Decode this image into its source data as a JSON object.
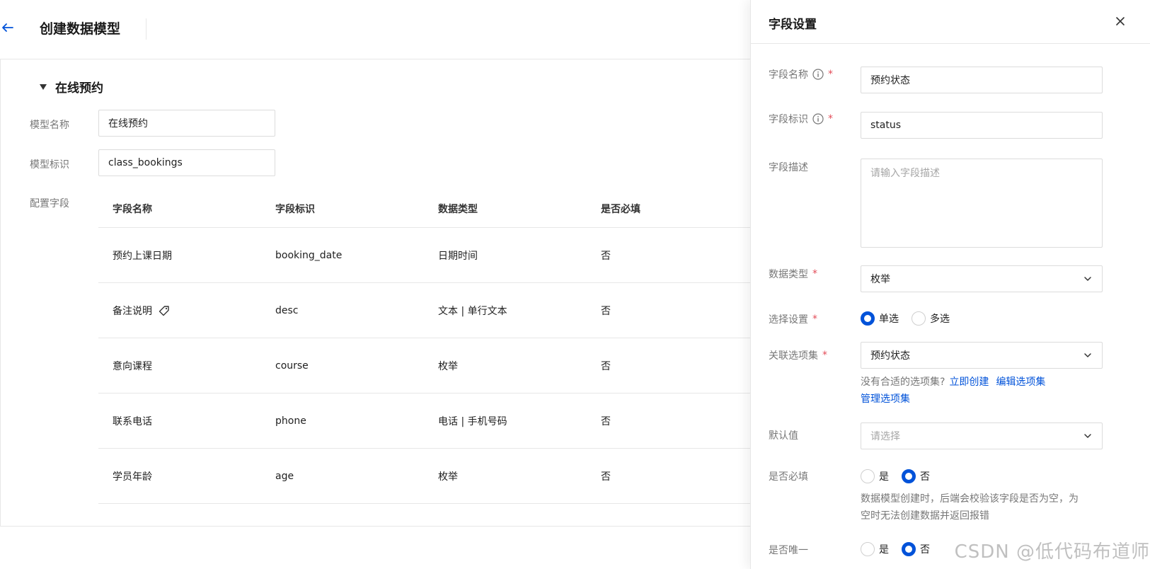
{
  "header": {
    "title": "创建数据模型"
  },
  "section": {
    "title": "在线预约"
  },
  "form": {
    "model_name_label": "模型名称",
    "model_name_value": "在线预约",
    "model_key_label": "模型标识",
    "model_key_value": "class_bookings",
    "fields_label": "配置字段"
  },
  "table": {
    "headers": [
      "字段名称",
      "字段标识",
      "数据类型",
      "是否必填"
    ],
    "rows": [
      {
        "name": "预约上课日期",
        "key": "booking_date",
        "type": "日期时间",
        "required": "否",
        "tag": false
      },
      {
        "name": "备注说明",
        "key": "desc",
        "type": "文本 | 单行文本",
        "required": "否",
        "tag": true
      },
      {
        "name": "意向课程",
        "key": "course",
        "type": "枚举",
        "required": "否",
        "tag": false
      },
      {
        "name": "联系电话",
        "key": "phone",
        "type": "电话 | 手机号码",
        "required": "否",
        "tag": false
      },
      {
        "name": "学员年龄",
        "key": "age",
        "type": "枚举",
        "required": "否",
        "tag": false
      }
    ]
  },
  "drawer": {
    "title": "字段设置",
    "field_name_label": "字段名称",
    "field_name_value": "预约状态",
    "field_key_label": "字段标识",
    "field_key_value": "status",
    "field_desc_label": "字段描述",
    "field_desc_placeholder": "请输入字段描述",
    "data_type_label": "数据类型",
    "data_type_value": "枚举",
    "select_setting_label": "选择设置",
    "select_single": "单选",
    "select_multi": "多选",
    "option_set_label": "关联选项集",
    "option_set_value": "预约状态",
    "option_hint": "没有合适的选项集?",
    "link_create": "立即创建",
    "link_edit": "编辑选项集",
    "link_manage": "管理选项集",
    "default_label": "默认值",
    "default_placeholder": "请选择",
    "required_label": "是否必填",
    "yes": "是",
    "no": "否",
    "required_hint_line1": "数据模型创建时，后端会校验该字段是否为空，为",
    "required_hint_line2": "空时无法创建数据并返回报错",
    "unique_label": "是否唯一",
    "required_marker": "*"
  },
  "watermark": "CSDN @低代码布道师",
  "colors": {
    "accent": "#0052d9",
    "required": "#e34d59",
    "border": "#dcdcdc"
  }
}
